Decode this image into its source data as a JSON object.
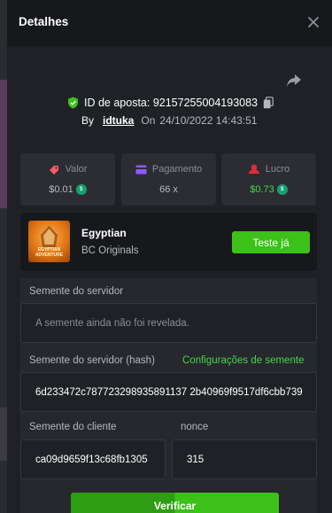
{
  "modal": {
    "title": "Detalhes"
  },
  "bet": {
    "id_label": "ID de aposta: 92157255004193083",
    "by_label": "By",
    "username": "idtuka",
    "on_label": "On",
    "datetime": "24/10/2022 14:43:51"
  },
  "stats": [
    {
      "label": "Valor",
      "value": "$0.01",
      "color": "#ff5a6a",
      "icon": "bet-amount-icon"
    },
    {
      "label": "Pagamento",
      "value": "66 x",
      "color": "#8e5bff",
      "icon": "payout-icon"
    },
    {
      "label": "Lucro",
      "value": "$0.73",
      "color": "#e02b3d",
      "icon": "profit-icon"
    }
  ],
  "game": {
    "name": "Egyptian",
    "provider": "BC Originals",
    "thumb_text": "EGYPTIAN ADVENTURE",
    "try_label": "Teste já"
  },
  "seeds": {
    "server_seed_label": "Semente do servidor",
    "server_seed_placeholder": "A semente ainda não foi revelada.",
    "server_hash_label": "Semente do servidor (hash)",
    "settings_link": "Configurações de semente",
    "server_hash_value": "6d233472c787723298935891137 2b40969f9517df6cbb739",
    "client_seed_label": "Semente do cliente",
    "client_seed_value": "ca09d9659f13c68fb1305",
    "nonce_label": "nonce",
    "nonce_value": "315",
    "verify_label": "Verificar"
  },
  "colors": {
    "accent_green": "#3bc117",
    "link_green": "#44d84a",
    "coin": "#16a071"
  }
}
